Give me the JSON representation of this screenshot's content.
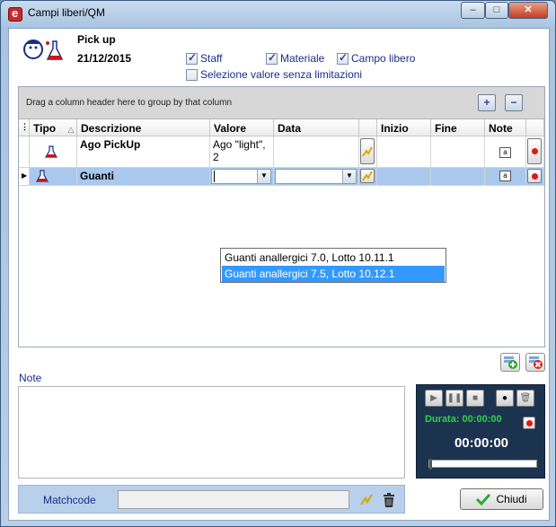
{
  "window": {
    "title": "Campi liberi/QM",
    "controls": [
      "minimize",
      "maximize",
      "close"
    ]
  },
  "header": {
    "title": "Pick up",
    "date": "21/12/2015"
  },
  "checkboxes": [
    {
      "label": "Staff",
      "checked": true
    },
    {
      "label": "Materiale",
      "checked": true
    },
    {
      "label": "Campo libero",
      "checked": true
    },
    {
      "label": "Selezione valore senza limitazioni",
      "checked": false
    }
  ],
  "grid": {
    "group_hint": "Drag a column header here to group by that column",
    "columns": [
      "Tipo",
      "Descrizione",
      "Valore",
      "Data",
      "Inizio",
      "Fine",
      "Note"
    ],
    "rows": [
      {
        "descrizione": "Ago PickUp",
        "valore": "Ago \"light\", 2",
        "selected": false
      },
      {
        "descrizione": "Guanti",
        "valore": "",
        "selected": true
      }
    ],
    "dropdown_options": [
      {
        "label": "Guanti anallergici 7.0, Lotto 10.11.1",
        "selected": false
      },
      {
        "label": "Guanti anallergici 7.5, Lotto 10.12.1",
        "selected": true
      }
    ]
  },
  "notes": {
    "label": "Note"
  },
  "recorder": {
    "durata_label": "Durata: 00:00:00",
    "time": "00:00:00"
  },
  "matchcode": {
    "label": "Matchcode",
    "value": ""
  },
  "chiudi": {
    "label": "Chiudi"
  },
  "colors": {
    "selected_row": "#a9c8ee",
    "dropdown_highlight": "#3399ff",
    "recorder_bg": "#1c3350",
    "durata_green": "#2fd14a"
  }
}
